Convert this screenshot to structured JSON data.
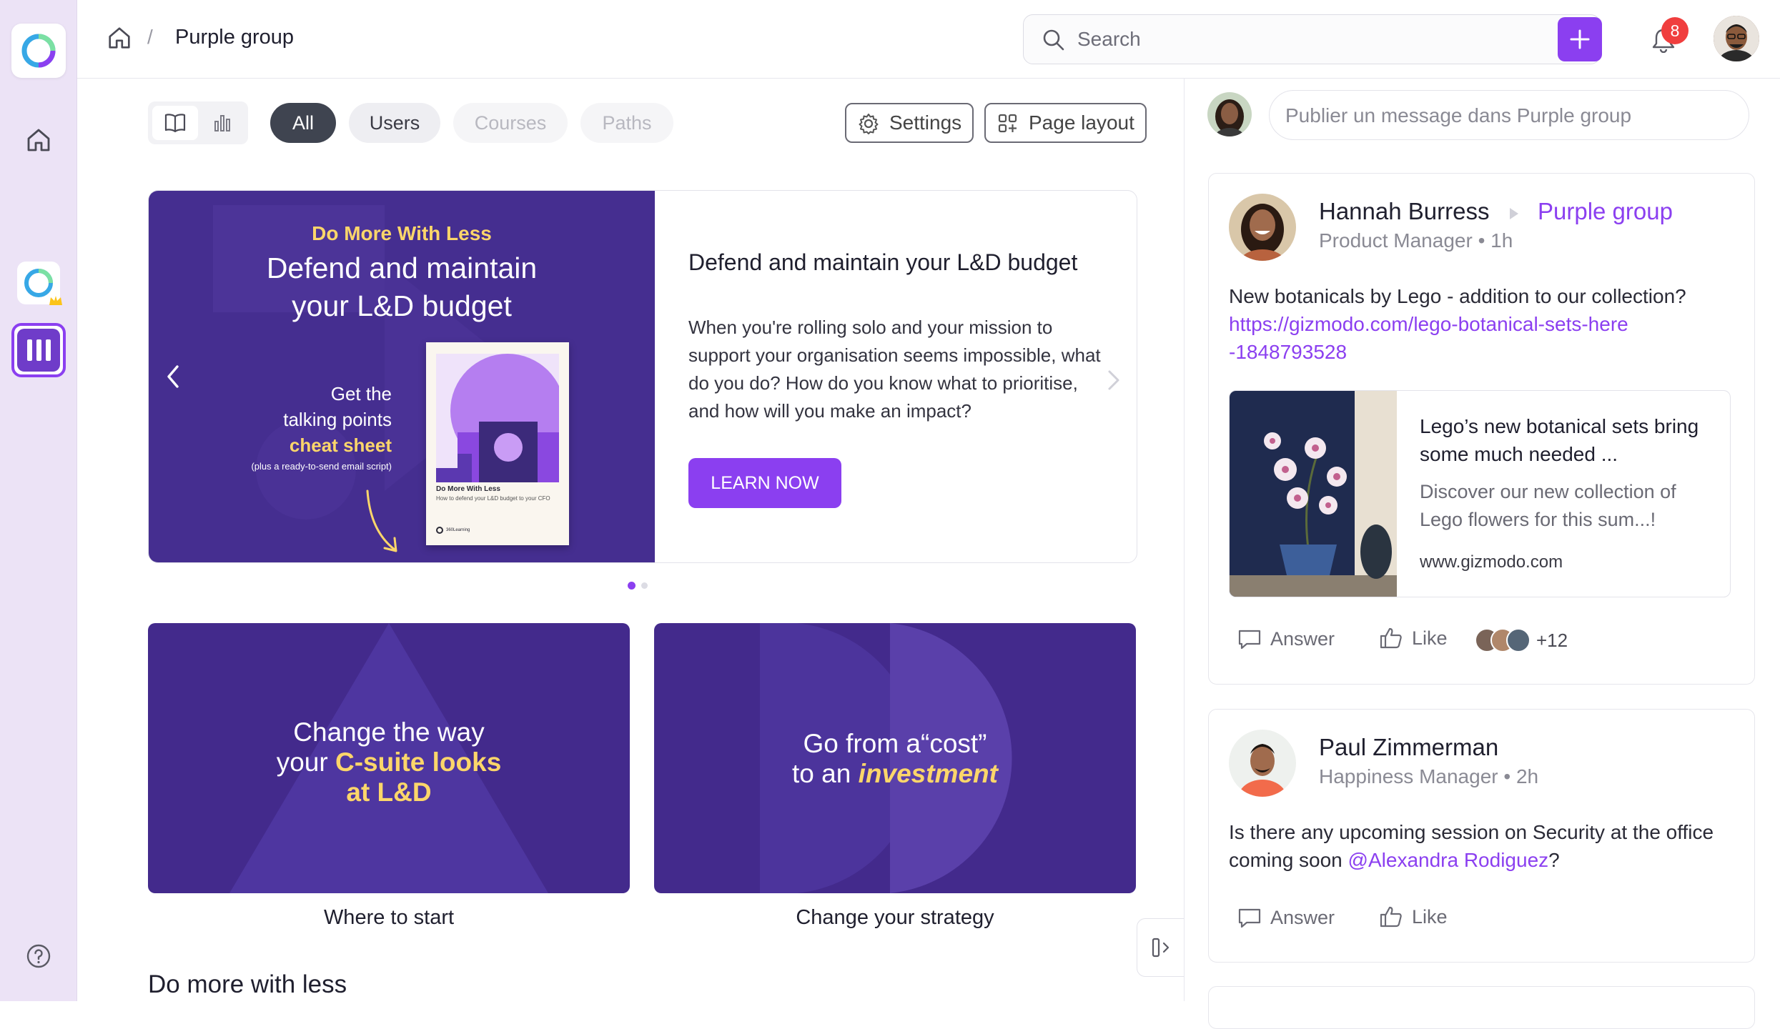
{
  "topbar": {
    "breadcrumb_current": "Purple group",
    "breadcrumb_separator": "/",
    "search_placeholder": "Search",
    "notification_count": "8"
  },
  "filters": {
    "tabs": [
      "All",
      "Users",
      "Courses",
      "Paths"
    ],
    "settings_label": "Settings",
    "page_layout_label": "Page layout"
  },
  "hero": {
    "image_kicker": "Do More With Less",
    "image_title_1": "Defend and maintain",
    "image_title_2": "your L&D budget",
    "image_get_1": "Get the",
    "image_get_2": "talking points",
    "image_get_3": "cheat sheet",
    "image_get_4": "(plus a ready-to-send email script)",
    "booklet_title": "Do More With Less",
    "booklet_sub": "How to defend your L&D budget to your CFO",
    "booklet_brand": "360Learning",
    "title": "Defend and maintain your L&D budget",
    "description": "When you're rolling solo and your mission to support your organisation seems impossible, what do you do? How do you know what to prioritise, and how will you make an impact?",
    "cta": "LEARN NOW"
  },
  "tiles": [
    {
      "line1": "Change the way",
      "line2_a": "your ",
      "line2_b": "C-suite looks",
      "line3": "at L&D",
      "caption": "Where to start"
    },
    {
      "line1": "Go from a“cost”",
      "line2_a": "to an ",
      "line2_b": "investment",
      "caption": "Change your strategy"
    }
  ],
  "section_title": "Do more with less",
  "composer": {
    "placeholder": "Publier un message dans Purple group"
  },
  "posts": [
    {
      "author": "Hannah Burress",
      "group": "Purple group",
      "role_time": "Product Manager • 1h",
      "text": "New botanicals by Lego - addition to our collection?",
      "link": "https://gizmodo.com/lego-botanical-sets-here-1848793528",
      "preview_title": "Lego’s new botanical sets bring some much needed ...",
      "preview_desc": "Discover our new collection of Lego flowers for this sum...!",
      "preview_domain": "www.gizmodo.com",
      "answer": "Answer",
      "like": "Like",
      "likes_extra": "+12"
    },
    {
      "author": "Paul Zimmerman",
      "role_time": "Happiness Manager • 2h",
      "text_before": "Is there any upcoming session on Security at the office coming soon ",
      "mention": "@Alexandra Rodiguez",
      "text_after": "?",
      "answer": "Answer",
      "like": "Like"
    }
  ],
  "colors": {
    "brand_purple": "#8b3ff0",
    "hero_purple": "#452e90",
    "accent_yellow": "#fcd66a",
    "notification_red": "#f03e3e"
  }
}
